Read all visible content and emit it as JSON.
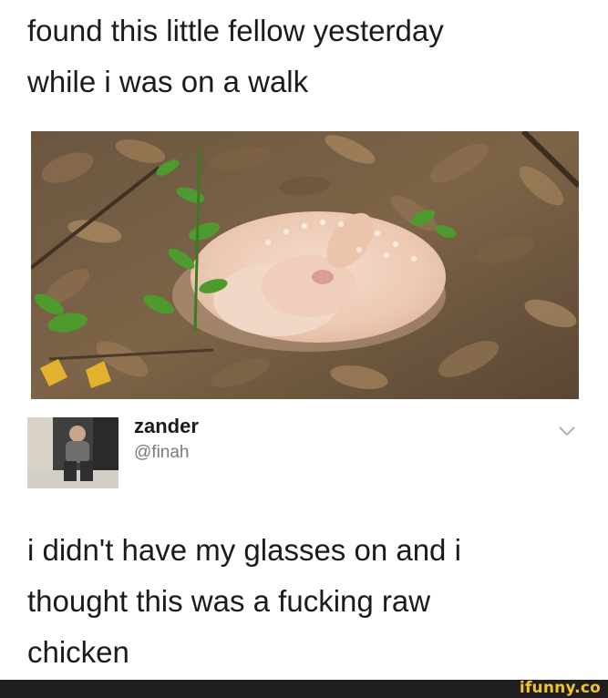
{
  "caption": {
    "line1": "found this little fellow yesterday",
    "line2": "while i was on a walk"
  },
  "photo": {
    "subject": "fawn-photo"
  },
  "tweet": {
    "display_name": "zander",
    "handle": "@finah",
    "text_line1": "i didn't have my glasses on and i",
    "text_line2": "thought this was a fucking raw",
    "text_line3": "chicken"
  },
  "watermark": {
    "brand": "ifunny.co",
    "color": "#f6c22a"
  },
  "icons": {
    "menu": "chevron-down-icon"
  }
}
